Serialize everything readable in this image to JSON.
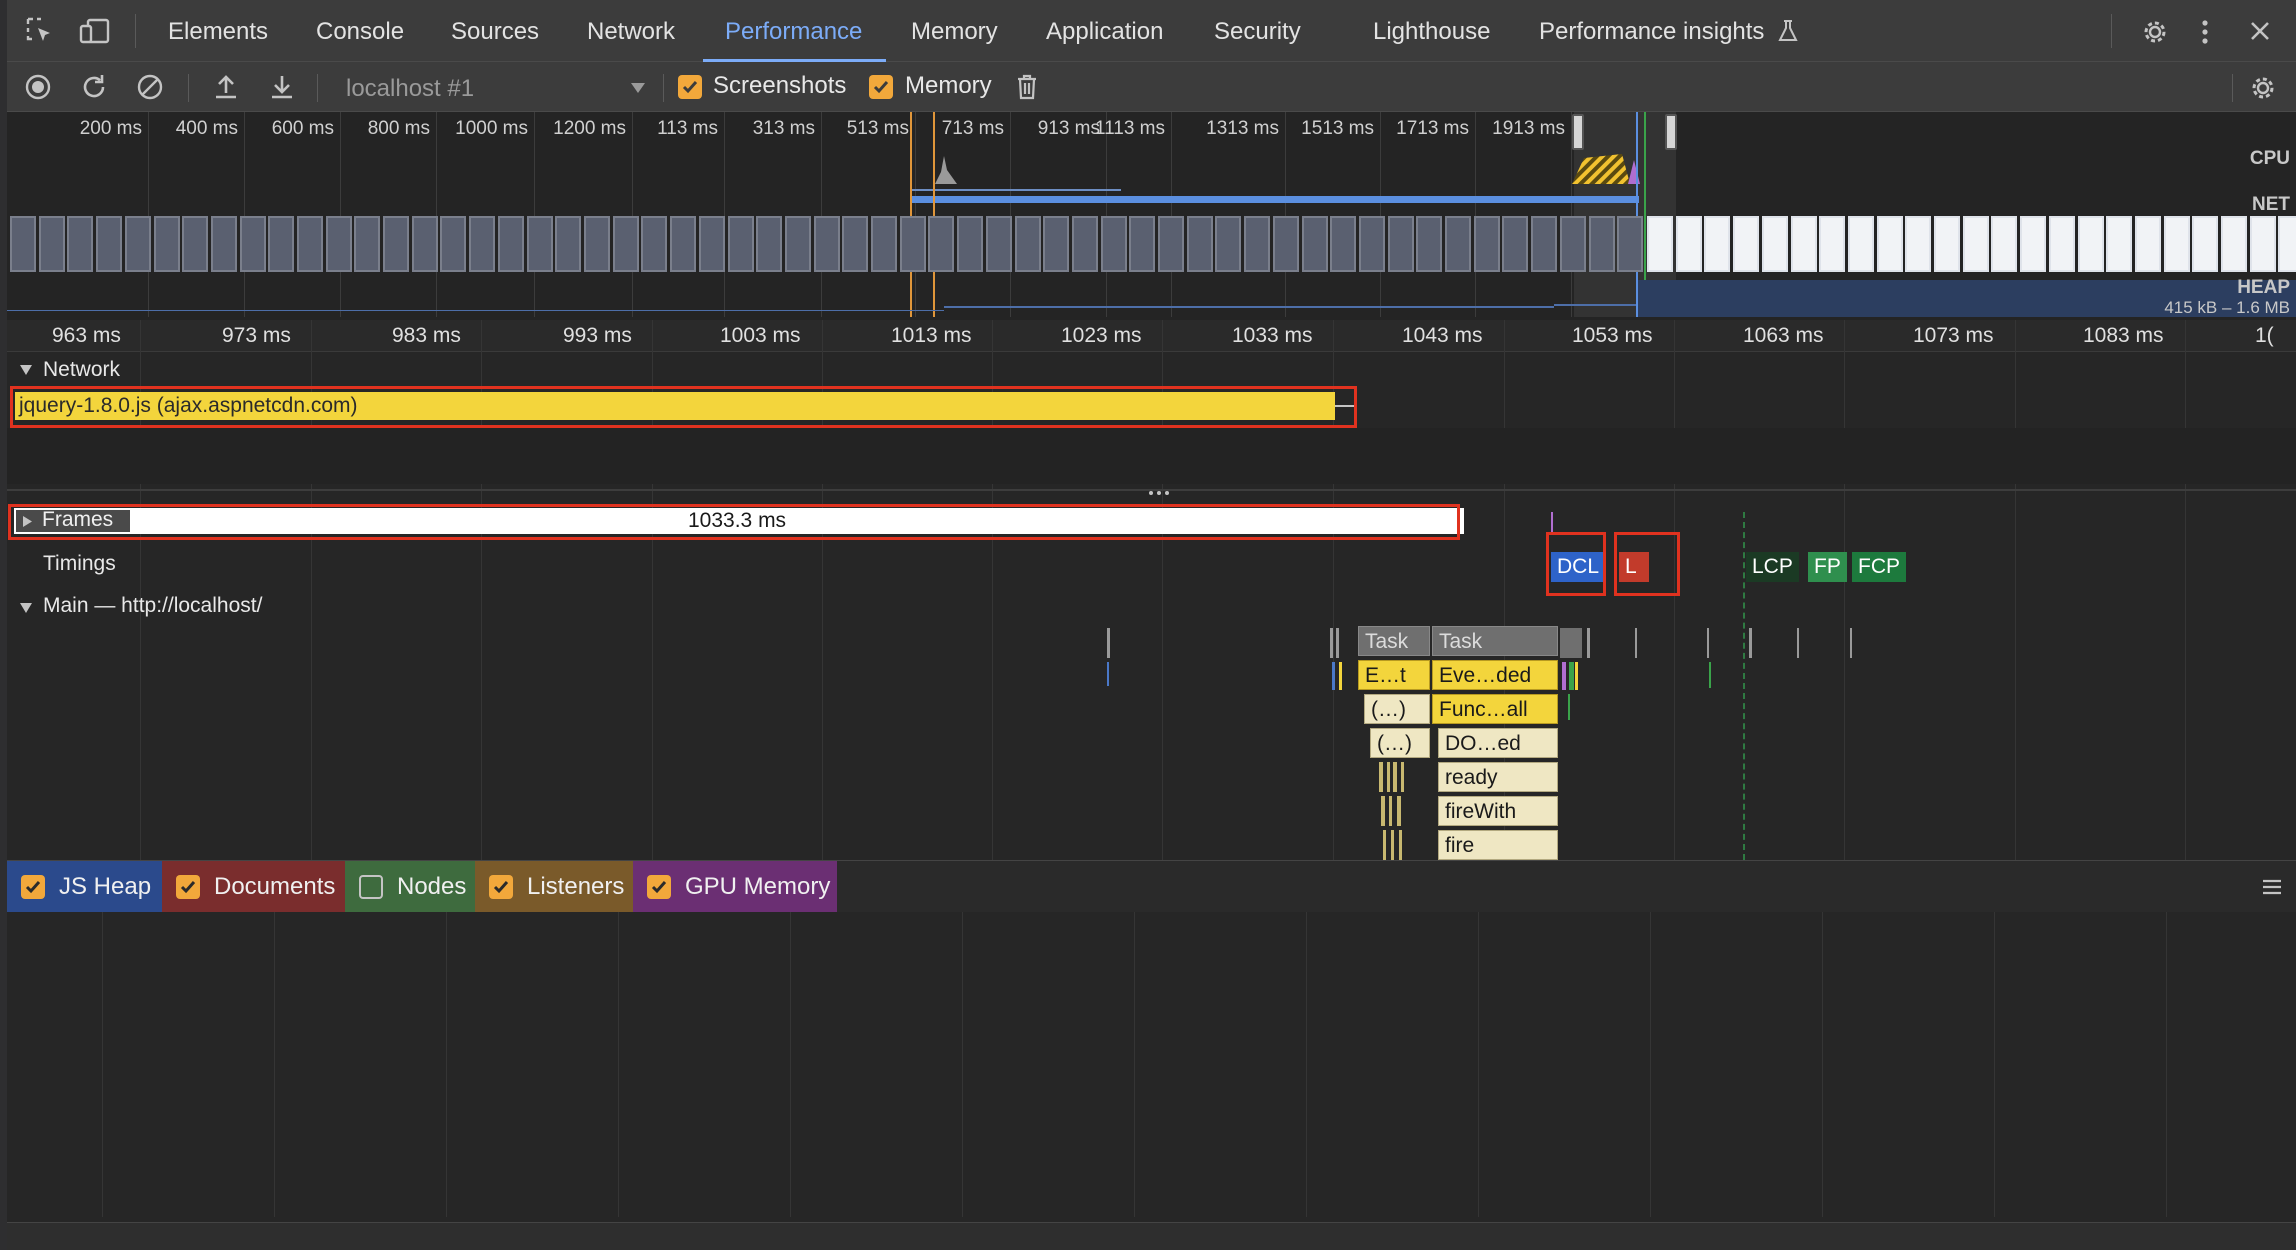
{
  "tabs": [
    {
      "label": "Elements",
      "active": false
    },
    {
      "label": "Console",
      "active": false
    },
    {
      "label": "Sources",
      "active": false
    },
    {
      "label": "Network",
      "active": false
    },
    {
      "label": "Performance",
      "active": true
    },
    {
      "label": "Memory",
      "active": false
    },
    {
      "label": "Application",
      "active": false
    },
    {
      "label": "Security",
      "active": false
    },
    {
      "label": "Lighthouse",
      "active": false
    },
    {
      "label": "Performance insights",
      "active": false
    }
  ],
  "toolbar": {
    "target": "localhost #1",
    "screenshots_label": "Screenshots",
    "screenshots_checked": true,
    "memory_label": "Memory",
    "memory_checked": true
  },
  "overview": {
    "ticks": [
      "200 ms",
      "400 ms",
      "600 ms",
      "800 ms",
      "1000 ms",
      "1200 ms",
      "113 ms",
      "313 ms",
      "513 ms",
      "713 ms",
      "913 ms",
      "1113 ms",
      "1313 ms",
      "1513 ms",
      "1713 ms",
      "1913 ms"
    ],
    "cpu_label": "CPU",
    "net_label": "NET",
    "heap_label": "HEAP",
    "heap_range": "415 kB – 1.6 MB"
  },
  "ruler": {
    "ticks": [
      "963 ms",
      "973 ms",
      "983 ms",
      "993 ms",
      "1003 ms",
      "1013 ms",
      "1023 ms",
      "1033 ms",
      "1043 ms",
      "1053 ms",
      "1063 ms",
      "1073 ms",
      "1083 ms",
      "1("
    ]
  },
  "network": {
    "title": "Network",
    "request": "jquery-1.8.0.js (ajax.aspnetcdn.com)"
  },
  "frames": {
    "title": "Frames",
    "duration": "1033.3 ms"
  },
  "timings": {
    "title": "Timings",
    "markers": [
      "DCL",
      "L",
      "LCP",
      "FP",
      "FCP"
    ]
  },
  "main": {
    "title": "Main — http://localhost/",
    "col1": [
      "Task",
      "E…t",
      "(…)",
      "(…)"
    ],
    "col2": [
      "Task",
      "Eve…ded",
      "Func…all",
      "DO…ed",
      "ready",
      "fireWith",
      "fire"
    ]
  },
  "counters": [
    {
      "label": "JS Heap",
      "checked": true,
      "color": "#2b4a8c"
    },
    {
      "label": "Documents",
      "checked": true,
      "color": "#7a2d2d"
    },
    {
      "label": "Nodes",
      "checked": false,
      "color": "#3e6b3e"
    },
    {
      "label": "Listeners",
      "checked": true,
      "color": "#7a5a2a"
    },
    {
      "label": "GPU Memory",
      "checked": true,
      "color": "#6b2f73"
    }
  ],
  "colors": {
    "accent": "#7cacf8",
    "checkbox": "#f2a83b",
    "highlight": "#e0321f",
    "network_bar": "#f3d53c"
  }
}
